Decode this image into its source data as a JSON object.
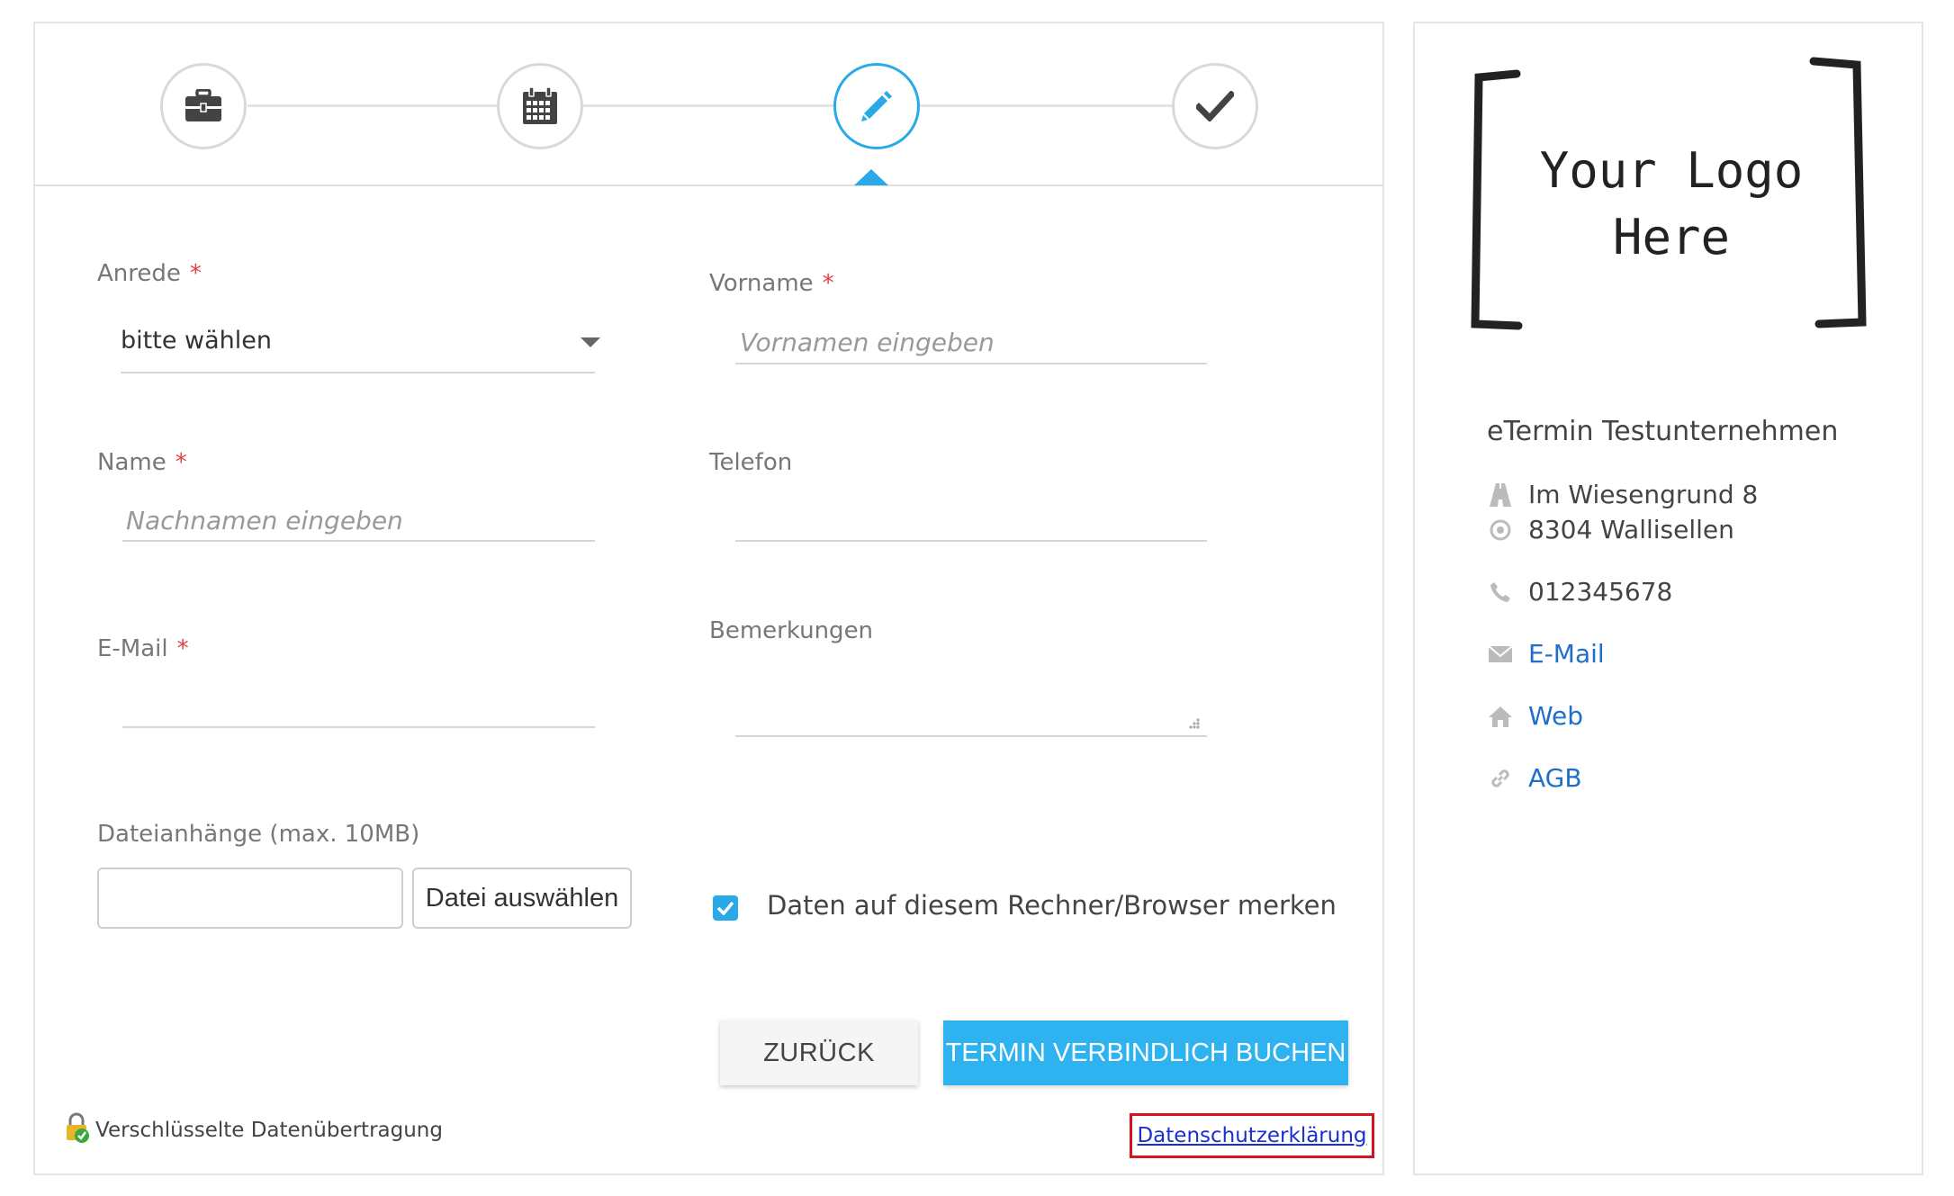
{
  "stepper": {
    "steps": [
      {
        "icon": "briefcase-icon"
      },
      {
        "icon": "calendar-icon"
      },
      {
        "icon": "pencil-icon",
        "active": true
      },
      {
        "icon": "checkmark-icon"
      }
    ],
    "active_color": "#29a9e8"
  },
  "form": {
    "salutation": {
      "label": "Anrede",
      "required_mark": "*",
      "value": "bitte wählen"
    },
    "first_name": {
      "label": "Vorname",
      "required_mark": "*",
      "placeholder": "Vornamen eingeben"
    },
    "last_name": {
      "label": "Name",
      "required_mark": "*",
      "placeholder": "Nachnamen eingeben"
    },
    "phone": {
      "label": "Telefon"
    },
    "email": {
      "label": "E-Mail",
      "required_mark": "*"
    },
    "remarks": {
      "label": "Bemerkungen"
    },
    "attachments": {
      "label": "Dateianhänge (max. 10MB)",
      "button": "Datei auswählen"
    },
    "remember": {
      "label": "Daten auf diesem Rechner/Browser merken",
      "checked": true
    }
  },
  "actions": {
    "back": "ZURÜCK",
    "book": "TERMIN VERBINDLICH BUCHEN"
  },
  "footer": {
    "secure_text": "Verschlüsselte Datenübertragung",
    "privacy_link": "Datenschutzerklärung"
  },
  "sidebar": {
    "logo_text_line1": "Your Logo",
    "logo_text_line2": "Here",
    "company": "eTermin Testunternehmen",
    "street": "Im Wiesengrund 8",
    "city": "8304 Wallisellen",
    "phone": "012345678",
    "email_link": "E-Mail",
    "web_link": "Web",
    "terms_link": "AGB"
  },
  "colors": {
    "accent": "#29a9e8",
    "button_primary": "#2eb3f0",
    "required": "#e04040",
    "link": "#1f6fc8",
    "highlight_border": "#d8121f"
  }
}
